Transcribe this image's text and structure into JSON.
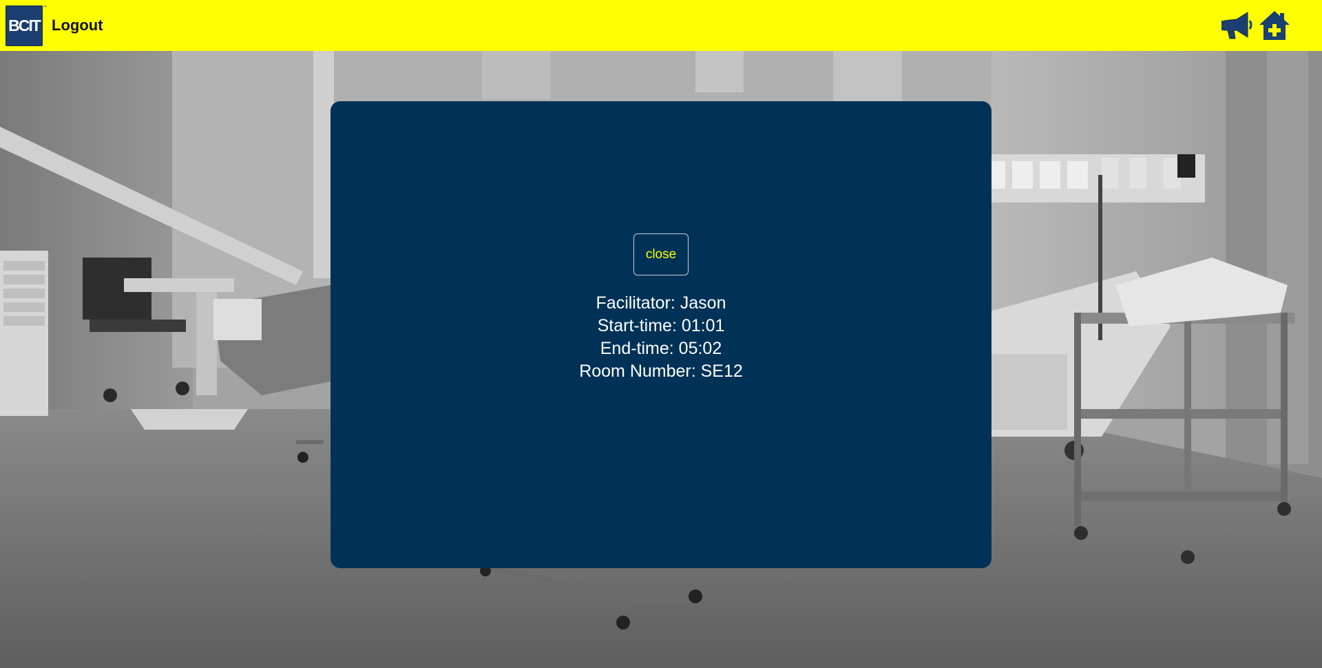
{
  "header": {
    "logo_text": "BCIT",
    "logo_mark": "™",
    "logout_label": "Logout",
    "background_color": "#ffff00",
    "icons": [
      {
        "name": "megaphone-icon",
        "color": "#1b3f70"
      },
      {
        "name": "home-plus-icon",
        "color": "#1b3f70"
      }
    ]
  },
  "modal": {
    "background_color": "#003257",
    "close_label": "close",
    "close_color": "#ffff00",
    "details": {
      "facilitator": "Facilitator: Jason",
      "start_time": "Start-time: 01:01",
      "end_time": "End-time: 05:02",
      "room_number": "Room Number: SE12"
    }
  }
}
